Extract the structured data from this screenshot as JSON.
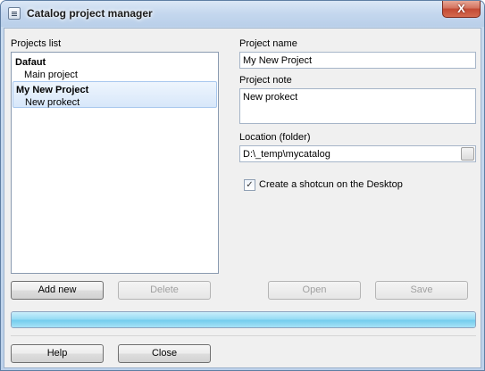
{
  "window": {
    "title": "Catalog project manager",
    "close_glyph": "X"
  },
  "projects": {
    "label": "Projects list",
    "items": [
      {
        "name": "Dafaut",
        "note": "Main project",
        "selected": false
      },
      {
        "name": "My New Project",
        "note": "New prokect",
        "selected": true
      }
    ]
  },
  "form": {
    "name_label": "Project name",
    "name_value": "My New Project",
    "note_label": "Project note",
    "note_value": "New prokect",
    "location_label": "Location (folder)",
    "location_value": "D:\\_temp\\mycatalog",
    "shortcut_label": "Create a shotcun on the Desktop",
    "shortcut_checked": true,
    "check_glyph": "✓"
  },
  "buttons": {
    "add_new": "Add new",
    "delete": "Delete",
    "open": "Open",
    "save": "Save",
    "help": "Help",
    "close": "Close"
  },
  "progress": {
    "fraction": 1.0
  },
  "colors": {
    "accent": "#74cdee",
    "selection": "#d7e7fa",
    "close_red": "#c24a34"
  }
}
